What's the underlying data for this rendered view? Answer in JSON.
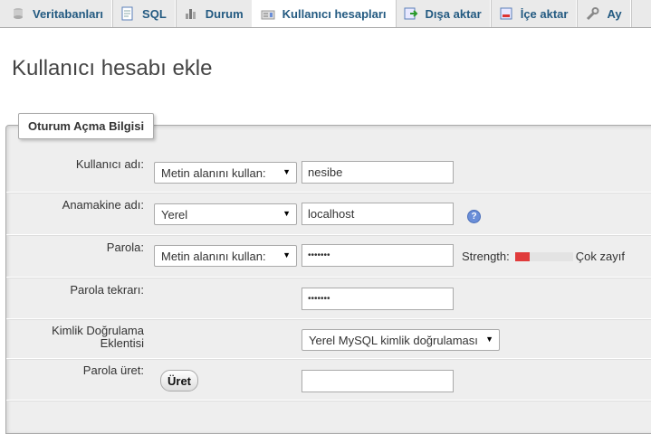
{
  "tabs": [
    {
      "label": "Veritabanları",
      "icon": "database-icon"
    },
    {
      "label": "SQL",
      "icon": "sql-icon"
    },
    {
      "label": "Durum",
      "icon": "status-chart-icon"
    },
    {
      "label": "Kullanıcı hesapları",
      "icon": "user-accounts-icon"
    },
    {
      "label": "Dışa aktar",
      "icon": "export-icon"
    },
    {
      "label": "İçe aktar",
      "icon": "import-icon"
    },
    {
      "label": "Ay",
      "icon": "wrench-icon"
    }
  ],
  "page_title": "Kullanıcı hesabı ekle",
  "fieldset_legend": "Oturum Açma Bilgisi",
  "form": {
    "username": {
      "label": "Kullanıcı adı:",
      "mode": "Metin alanını kullan:",
      "value": "nesibe"
    },
    "host": {
      "label": "Anamakine adı:",
      "mode": "Yerel",
      "value": "localhost"
    },
    "password": {
      "label": "Parola:",
      "mode": "Metin alanını kullan:",
      "value": "•••••••",
      "strength_label": "Strength:",
      "strength_text": "Çok zayıf",
      "strength_fraction": 0.25
    },
    "password_repeat": {
      "label": "Parola tekrarı:",
      "value": "•••••••"
    },
    "auth_plugin": {
      "label_line1": "Kimlik Doğrulama",
      "label_line2": "Eklentisi",
      "value": "Yerel MySQL kimlik doğrulaması"
    },
    "generate": {
      "label": "Parola üret:",
      "button": "Üret",
      "value": ""
    }
  }
}
